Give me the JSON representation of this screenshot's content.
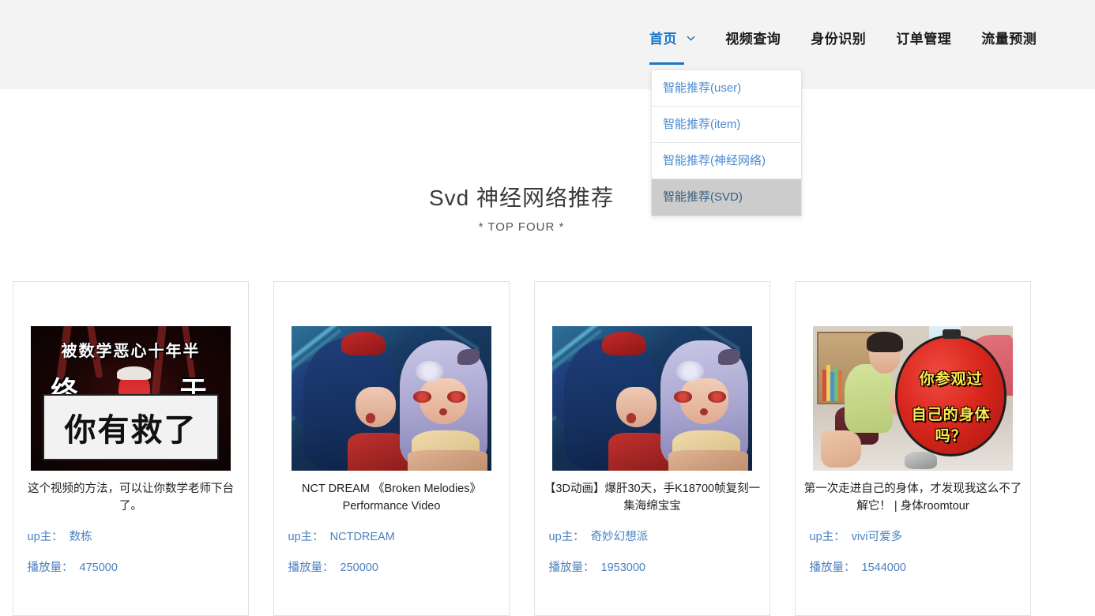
{
  "header": {
    "nav": [
      {
        "label": "首页",
        "active": true,
        "has_chevron": true
      },
      {
        "label": "视频查询",
        "active": false,
        "has_chevron": false
      },
      {
        "label": "身份识别",
        "active": false,
        "has_chevron": false
      },
      {
        "label": "订单管理",
        "active": false,
        "has_chevron": false
      },
      {
        "label": "流量预测",
        "active": false,
        "has_chevron": false
      }
    ],
    "accent_color": "#1677c8",
    "background_color": "#f3f3f3"
  },
  "dropdown": {
    "open": true,
    "items": [
      {
        "label": "智能推荐(user)",
        "selected": false
      },
      {
        "label": "智能推荐(item)",
        "selected": false
      },
      {
        "label": "智能推荐(神经网络)",
        "selected": false
      },
      {
        "label": "智能推荐(SVD)",
        "selected": true
      }
    ],
    "item_color": "#4a8bd0",
    "selected_background": "#cccccc"
  },
  "main": {
    "title": "Svd 神经网络推荐",
    "subtitle": "* TOP FOUR *",
    "meta_label_uploader": "up主：",
    "meta_label_views": "播放量：",
    "cards": [
      {
        "title": "这个视频的方法，可以让你数学老师下台了。",
        "uploader": "数栋",
        "views": "475000",
        "thumbnail": {
          "kind": "math-meme-thumbnail",
          "text_top": "被数学恶心十年半",
          "text_left": "终",
          "text_right": "于",
          "text_box": "你有救了"
        }
      },
      {
        "title": "NCT DREAM 《Broken Melodies》Performance Video",
        "uploader": "NCTDREAM",
        "views": "250000",
        "thumbnail": {
          "kind": "anime-duo-thumbnail",
          "text_top": "",
          "text_left": "",
          "text_right": "",
          "text_box": ""
        }
      },
      {
        "title": "【3D动画】爆肝30天，手K18700帧复刻一集海绵宝宝",
        "uploader": "奇妙幻想派",
        "views": "1953000",
        "thumbnail": {
          "kind": "anime-duo-thumbnail",
          "text_top": "",
          "text_left": "",
          "text_right": "",
          "text_box": ""
        }
      },
      {
        "title": "第一次走进自己的身体，才发现我这么不了解它！ | 身体roomtour",
        "uploader": "vivi可爱多",
        "views": "1544000",
        "thumbnail": {
          "kind": "roomtour-thumbnail",
          "ref_text_a": "你参观过",
          "ref_text_b": "自己的身体吗？"
        }
      }
    ]
  }
}
